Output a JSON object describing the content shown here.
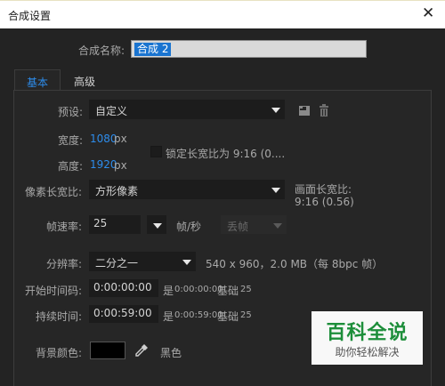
{
  "window": {
    "title": "合成设置",
    "close_glyph": "✕"
  },
  "composition_name": {
    "label": "合成名称:",
    "value": "合成 2"
  },
  "tabs": [
    {
      "label": "基本"
    },
    {
      "label": "高级"
    }
  ],
  "preset": {
    "label": "预设:",
    "value": "自定义"
  },
  "width": {
    "label": "宽度:",
    "value": "1080",
    "unit": "px"
  },
  "height": {
    "label": "高度:",
    "value": "1920",
    "unit": "px"
  },
  "lock_aspect": {
    "label": "锁定长宽比为 9:16 (0...."
  },
  "pixel_aspect": {
    "label": "像素长宽比:",
    "value": "方形像素"
  },
  "frame_aspect": {
    "label": "画面长宽比:",
    "value": "9:16 (0.56)"
  },
  "frame_rate": {
    "label": "帧速率:",
    "value": "25",
    "unit": "帧/秒",
    "drop_frame": "丢帧"
  },
  "resolution": {
    "label": "分辨率:",
    "value": "二分之一",
    "info": "540 x 960，2.0 MB（每 8bpc 帧）"
  },
  "start_timecode": {
    "label": "开始时间码:",
    "value": "0:00:00:00",
    "is_prefix": "是",
    "is_value": "0:00:00:00",
    "base_label": "基础",
    "base_value": "25"
  },
  "duration": {
    "label": "持续时间:",
    "value": "0:00:59:00",
    "is_prefix": "是",
    "is_value": "0:00:59:00",
    "base_label": "基础",
    "base_value": "25"
  },
  "background_color": {
    "label": "背景颜色:",
    "name": "黑色",
    "color": "#000000"
  },
  "watermark": {
    "big": "百科全说",
    "sub": "助你轻松解决"
  },
  "icons": {
    "save_preset": "save-preset-icon",
    "delete_preset": "trash-icon",
    "eyedropper": "eyedropper-icon"
  }
}
